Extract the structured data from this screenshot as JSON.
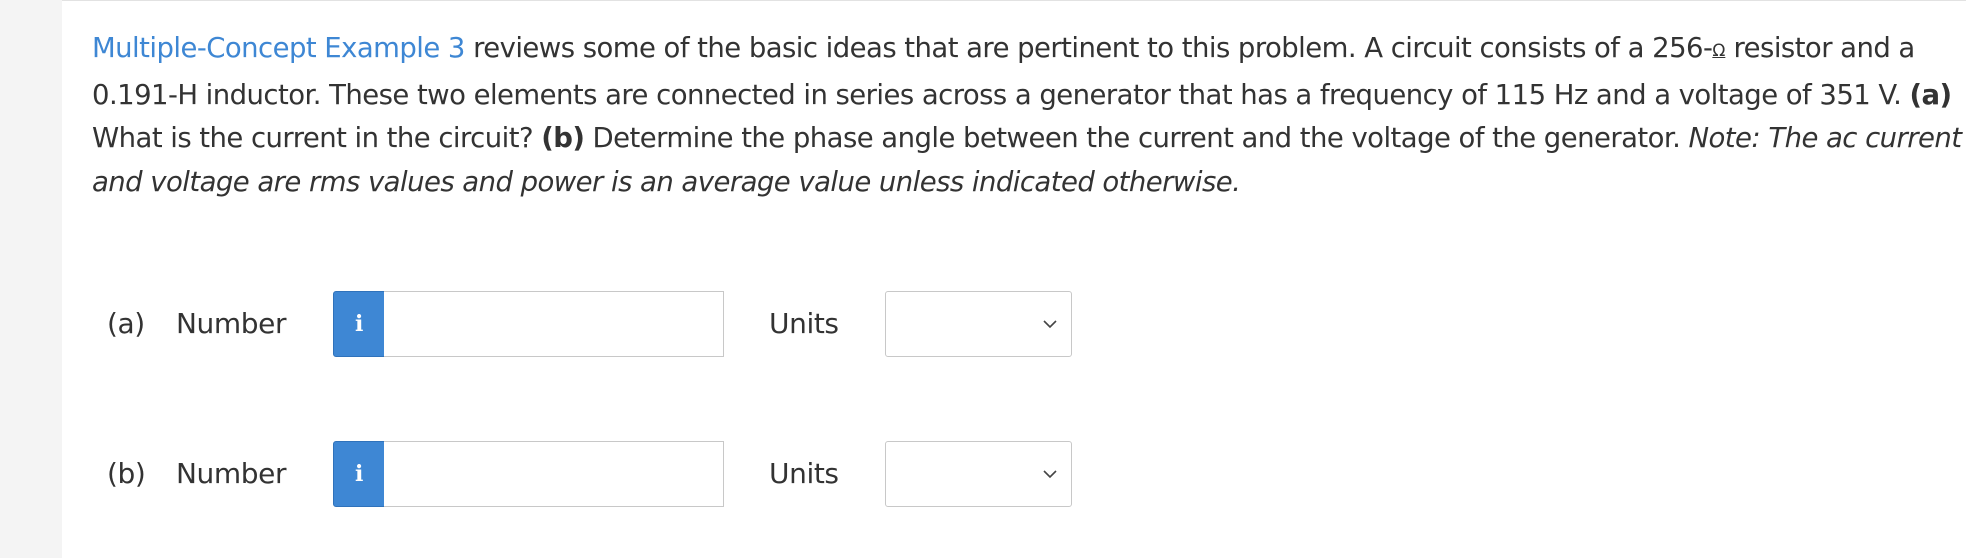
{
  "question": {
    "link_text": "Multiple-Concept Example 3",
    "text_1": " reviews some of the basic ideas that are pertinent to this problem. A circuit consists of a 256-",
    "ohm_symbol": "Ω",
    "text_2": " resistor and a 0.191-H inductor. These two elements are connected in series across a generator that has a frequency of 115 Hz and a voltage of 351 V. ",
    "part_a_marker": "(a)",
    "part_a_text": " What is the current in the circuit? ",
    "part_b_marker": "(b)",
    "part_b_text": " Determine the phase angle between the current and the voltage of the generator. ",
    "note": "Note: The ac current and voltage are rms values and power is an average value unless indicated otherwise."
  },
  "answers": [
    {
      "part_label": "(a)",
      "number_label": "Number",
      "info_icon": "i",
      "number_value": "",
      "units_label": "Units",
      "units_selected": ""
    },
    {
      "part_label": "(b)",
      "number_label": "Number",
      "info_icon": "i",
      "number_value": "",
      "units_label": "Units",
      "units_selected": ""
    }
  ],
  "colors": {
    "link": "#3e87d4",
    "info_button": "#3e87d4",
    "text": "#333333"
  }
}
